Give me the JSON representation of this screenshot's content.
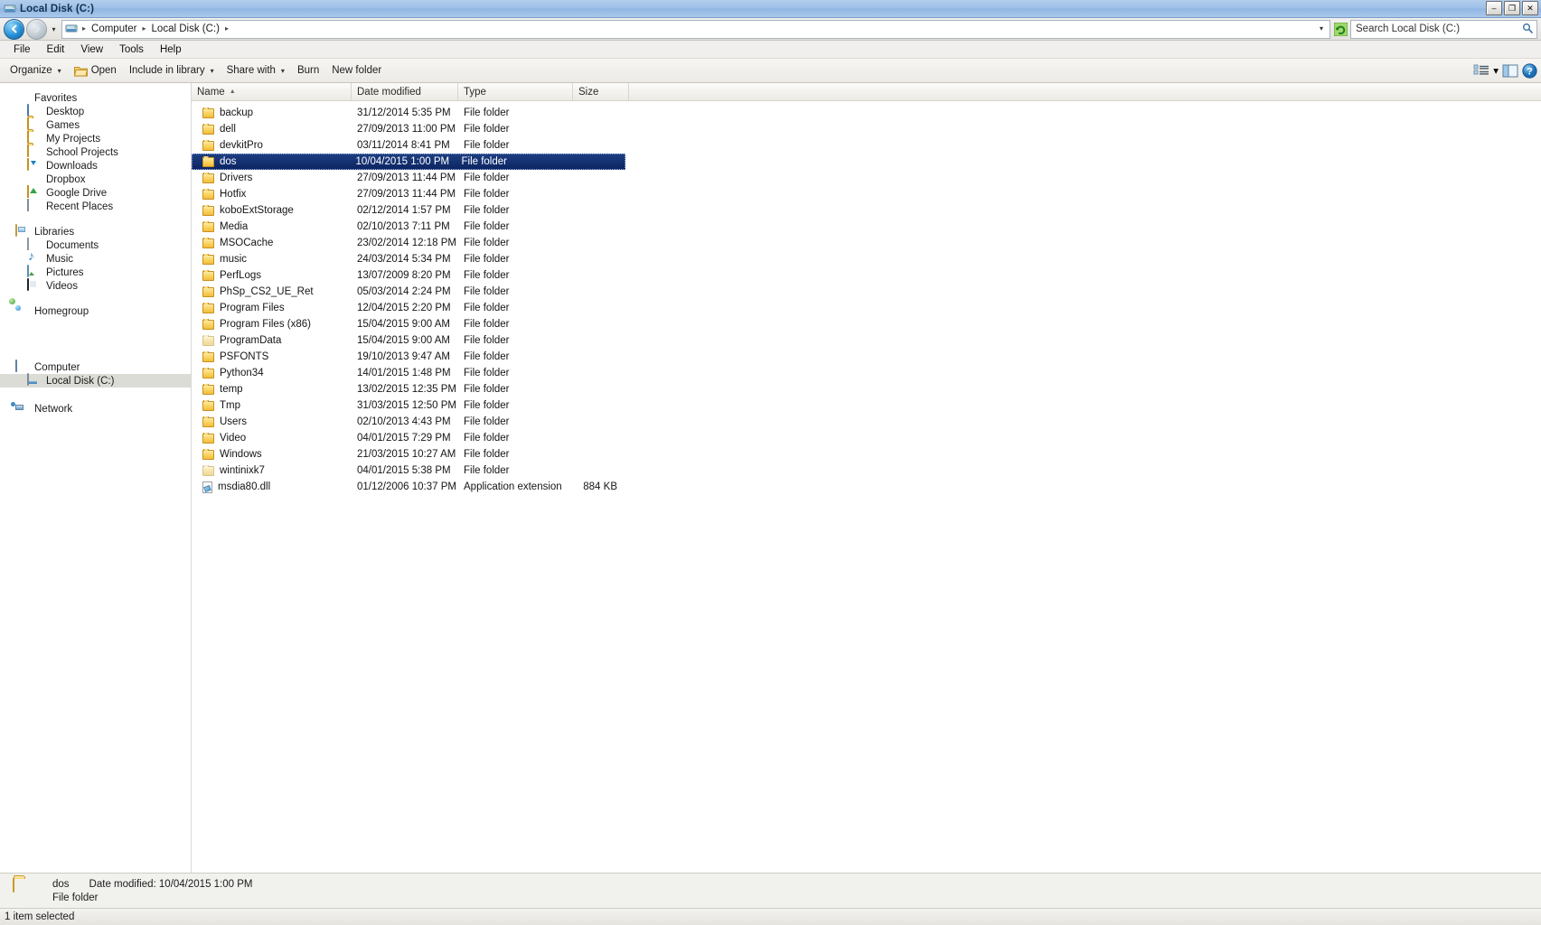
{
  "window": {
    "title": "Local Disk (C:)",
    "controls": {
      "minimize": "–",
      "restore": "❐",
      "close": "✕"
    }
  },
  "address": {
    "back_label": "◀",
    "forward_label": "▶",
    "history_caret": "▾",
    "crumbs": [
      "Computer",
      "Local Disk (C:)"
    ],
    "separator": "▸",
    "caret": "▾",
    "refresh_label": "⟳"
  },
  "search": {
    "placeholder": "Search Local Disk (C:)",
    "value": ""
  },
  "menubar": {
    "items": [
      "File",
      "Edit",
      "View",
      "Tools",
      "Help"
    ]
  },
  "commandbar": {
    "organize": "Organize",
    "open": "Open",
    "include_in_library": "Include in library",
    "share_with": "Share with",
    "burn": "Burn",
    "new_folder": "New folder",
    "caret": "▾",
    "view_icon": "view-options-icon",
    "preview_icon": "preview-pane-icon",
    "help_icon": "help-icon"
  },
  "sidebar": {
    "groups": [
      {
        "name": "Favorites",
        "icon": "star-icon",
        "items": [
          {
            "label": "Desktop",
            "icon": "monitor-icon"
          },
          {
            "label": "Games",
            "icon": "folder-icon"
          },
          {
            "label": "My Projects",
            "icon": "folder-icon"
          },
          {
            "label": "School Projects",
            "icon": "folder-icon"
          },
          {
            "label": "Downloads",
            "icon": "download-folder-icon"
          },
          {
            "label": "Dropbox",
            "icon": "dropbox-icon"
          },
          {
            "label": "Google Drive",
            "icon": "google-drive-icon"
          },
          {
            "label": "Recent Places",
            "icon": "recent-places-icon"
          }
        ]
      },
      {
        "name": "Libraries",
        "icon": "libraries-icon",
        "items": [
          {
            "label": "Documents",
            "icon": "document-icon"
          },
          {
            "label": "Music",
            "icon": "music-icon"
          },
          {
            "label": "Pictures",
            "icon": "pictures-icon"
          },
          {
            "label": "Videos",
            "icon": "video-icon"
          }
        ]
      },
      {
        "name": "Homegroup",
        "icon": "homegroup-icon",
        "items": []
      },
      {
        "name": "Computer",
        "icon": "computer-icon",
        "items": [
          {
            "label": "Local Disk (C:)",
            "icon": "drive-icon",
            "selected": true
          }
        ]
      },
      {
        "name": "Network",
        "icon": "network-icon",
        "items": []
      }
    ]
  },
  "filelist": {
    "columns": [
      {
        "key": "name",
        "label": "Name",
        "sorted": true,
        "sort_arrow": "▲"
      },
      {
        "key": "date",
        "label": "Date modified"
      },
      {
        "key": "type",
        "label": "Type"
      },
      {
        "key": "size",
        "label": "Size"
      }
    ],
    "rows": [
      {
        "name": "backup",
        "date": "31/12/2014 5:35 PM",
        "type": "File folder",
        "size": "",
        "icon": "folder-icon"
      },
      {
        "name": "dell",
        "date": "27/09/2013 11:00 PM",
        "type": "File folder",
        "size": "",
        "icon": "folder-icon"
      },
      {
        "name": "devkitPro",
        "date": "03/11/2014 8:41 PM",
        "type": "File folder",
        "size": "",
        "icon": "folder-icon"
      },
      {
        "name": "dos",
        "date": "10/04/2015 1:00 PM",
        "type": "File folder",
        "size": "",
        "icon": "folder-icon",
        "selected": true
      },
      {
        "name": "Drivers",
        "date": "27/09/2013 11:44 PM",
        "type": "File folder",
        "size": "",
        "icon": "folder-icon"
      },
      {
        "name": "Hotfix",
        "date": "27/09/2013 11:44 PM",
        "type": "File folder",
        "size": "",
        "icon": "folder-icon"
      },
      {
        "name": "koboExtStorage",
        "date": "02/12/2014 1:57 PM",
        "type": "File folder",
        "size": "",
        "icon": "folder-icon"
      },
      {
        "name": "Media",
        "date": "02/10/2013 7:11 PM",
        "type": "File folder",
        "size": "",
        "icon": "folder-icon"
      },
      {
        "name": "MSOCache",
        "date": "23/02/2014 12:18 PM",
        "type": "File folder",
        "size": "",
        "icon": "folder-icon"
      },
      {
        "name": "music",
        "date": "24/03/2014 5:34 PM",
        "type": "File folder",
        "size": "",
        "icon": "folder-icon"
      },
      {
        "name": "PerfLogs",
        "date": "13/07/2009 8:20 PM",
        "type": "File folder",
        "size": "",
        "icon": "folder-icon"
      },
      {
        "name": "PhSp_CS2_UE_Ret",
        "date": "05/03/2014 2:24 PM",
        "type": "File folder",
        "size": "",
        "icon": "folder-icon"
      },
      {
        "name": "Program Files",
        "date": "12/04/2015 2:20 PM",
        "type": "File folder",
        "size": "",
        "icon": "folder-icon"
      },
      {
        "name": "Program Files (x86)",
        "date": "15/04/2015 9:00 AM",
        "type": "File folder",
        "size": "",
        "icon": "folder-icon"
      },
      {
        "name": "ProgramData",
        "date": "15/04/2015 9:00 AM",
        "type": "File folder",
        "size": "",
        "icon": "folder-icon-hidden"
      },
      {
        "name": "PSFONTS",
        "date": "19/10/2013 9:47 AM",
        "type": "File folder",
        "size": "",
        "icon": "folder-icon"
      },
      {
        "name": "Python34",
        "date": "14/01/2015 1:48 PM",
        "type": "File folder",
        "size": "",
        "icon": "folder-icon"
      },
      {
        "name": "temp",
        "date": "13/02/2015 12:35 PM",
        "type": "File folder",
        "size": "",
        "icon": "folder-icon"
      },
      {
        "name": "Tmp",
        "date": "31/03/2015 12:50 PM",
        "type": "File folder",
        "size": "",
        "icon": "folder-icon"
      },
      {
        "name": "Users",
        "date": "02/10/2013 4:43 PM",
        "type": "File folder",
        "size": "",
        "icon": "folder-icon"
      },
      {
        "name": "Video",
        "date": "04/01/2015 7:29 PM",
        "type": "File folder",
        "size": "",
        "icon": "folder-icon"
      },
      {
        "name": "Windows",
        "date": "21/03/2015 10:27 AM",
        "type": "File folder",
        "size": "",
        "icon": "folder-icon"
      },
      {
        "name": "wintinixk7",
        "date": "04/01/2015 5:38 PM",
        "type": "File folder",
        "size": "",
        "icon": "folder-icon-hidden"
      },
      {
        "name": "msdia80.dll",
        "date": "01/12/2006 10:37 PM",
        "type": "Application extension",
        "size": "884 KB",
        "icon": "dll-icon"
      }
    ]
  },
  "details_pane": {
    "name": "dos",
    "date_label": "Date modified:",
    "date_value": "10/04/2015 1:00 PM",
    "type": "File folder",
    "icon": "folder-large-icon"
  },
  "statusbar": {
    "text": "1 item selected"
  },
  "colors": {
    "selection": "#0c2461",
    "titlebar": "#9fc1e8",
    "folder": "#f2bd3c",
    "accent_green": "#3aa14b"
  }
}
